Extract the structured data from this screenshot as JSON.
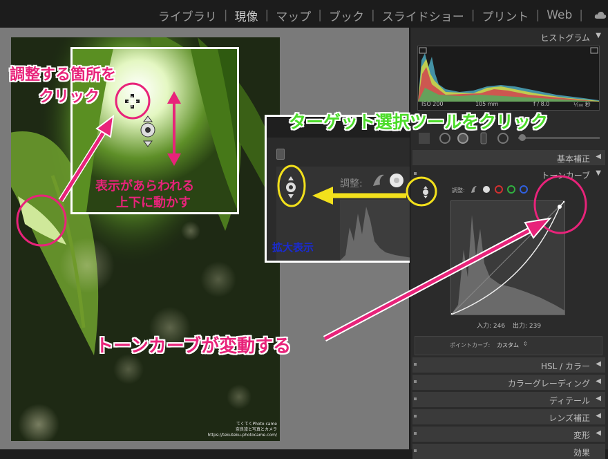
{
  "nav": {
    "modules": [
      "ライブラリ",
      "現像",
      "マップ",
      "ブック",
      "スライドショー",
      "プリント",
      "Web"
    ],
    "active": "現像"
  },
  "panel": {
    "histogram_title": "ヒストグラム",
    "camera_info": {
      "iso": "ISO 200",
      "focal": "105 mm",
      "aperture": "f / 8.0",
      "shutter": "¹⁄₁₀₀ 秒"
    },
    "basic_title": "基本補正",
    "tone_title": "トーンカーブ",
    "adjust_label": "調整:",
    "input_label": "入力:",
    "input_value": "246",
    "output_label": "出力:",
    "output_value": "239",
    "point_curve_label": "ポイントカーブ:",
    "point_curve_value": "カスタム",
    "sections": [
      "HSL / カラー",
      "カラーグレーディング",
      "ディテール",
      "レンズ補正",
      "変形",
      "効果"
    ]
  },
  "annotations": {
    "click_spot_line1": "調整する箇所を",
    "click_spot_line2": "クリック",
    "shown_line1": "表示があらわれる",
    "shown_line2": "上下に動かす",
    "target_tool": "ターゲット選択ツールをクリック",
    "zoomed": "拡大表示",
    "inset_adjust_label": "調整:",
    "curve_changes": "トーンカーブが変動する"
  },
  "watermark": {
    "line1": "てくてくPhoto came",
    "line2": "奈良旅と写真とカメラ",
    "line3": "https://tekuteku-photocame.com/"
  },
  "colors": {
    "pink": "#e8237a",
    "yellow": "#f2e01c",
    "green": "#4cdc2a",
    "blue": "#1a2bd0"
  }
}
